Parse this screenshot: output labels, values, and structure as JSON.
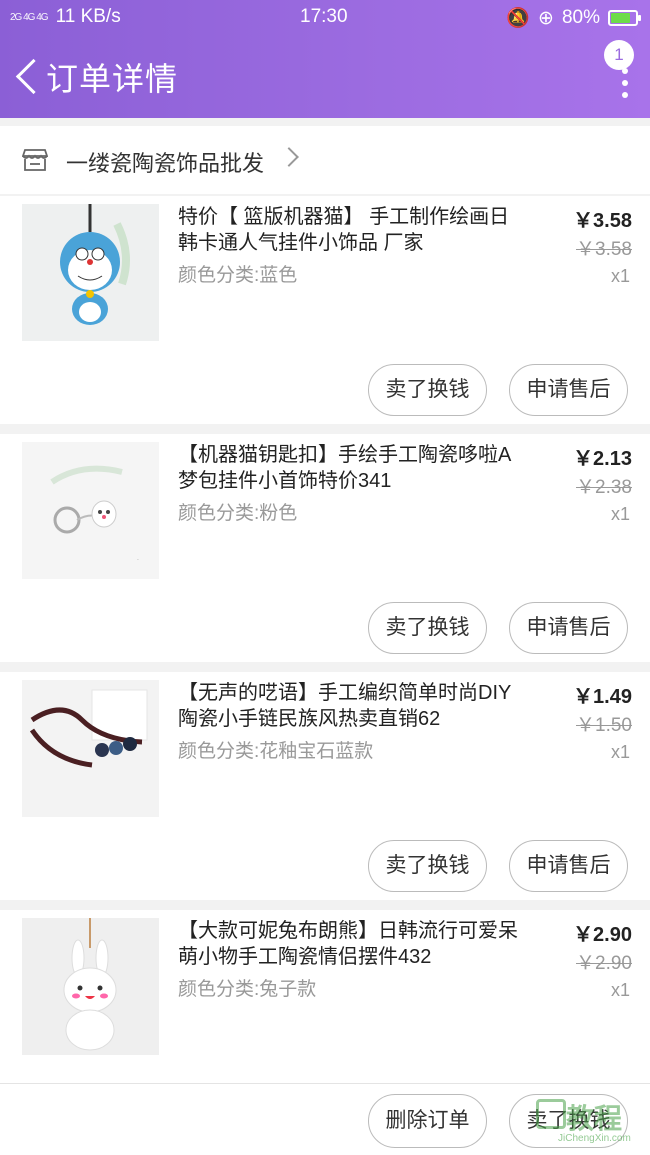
{
  "status_bar": {
    "network": "2G 4G 4G",
    "speed": "11 KB/s",
    "time": "17:30",
    "battery": "80%",
    "battery_level": 0.8
  },
  "header": {
    "title": "订单详情",
    "badge_count": "1"
  },
  "shop": {
    "name": "一缕瓷陶瓷饰品批发"
  },
  "items": [
    {
      "name": "特价【 篮版机器猫】 手工制作绘画日韩卡通人气挂件小饰品 厂家",
      "attr": "颜色分类:蓝色",
      "price": "￥3.58",
      "original_price": "￥3.58",
      "qty": "x1",
      "sell_label": "卖了换钱",
      "after_sale_label": "申请售后"
    },
    {
      "name": "【机器猫钥匙扣】手绘手工陶瓷哆啦A梦包挂件小首饰特价341",
      "attr": "颜色分类:粉色",
      "price": "￥2.13",
      "original_price": "￥2.38",
      "qty": "x1",
      "sell_label": "卖了换钱",
      "after_sale_label": "申请售后"
    },
    {
      "name": "【无声的呓语】手工编织简单时尚DIY陶瓷小手链民族风热卖直销62",
      "attr": "颜色分类:花釉宝石蓝款",
      "price": "￥1.49",
      "original_price": "￥1.50",
      "qty": "x1",
      "sell_label": "卖了换钱",
      "after_sale_label": "申请售后"
    },
    {
      "name": "【大款可妮兔布朗熊】日韩流行可爱呆萌小物手工陶瓷情侣摆件432",
      "attr": "颜色分类:兔子款",
      "price": "￥2.90",
      "original_price": "￥2.90",
      "qty": "x1"
    }
  ],
  "bottom_bar": {
    "delete_label": "删除订单",
    "sell_label": "卖了换钱"
  },
  "watermark": {
    "text_cn": "教程",
    "text_en": "JiChengXin.com"
  }
}
